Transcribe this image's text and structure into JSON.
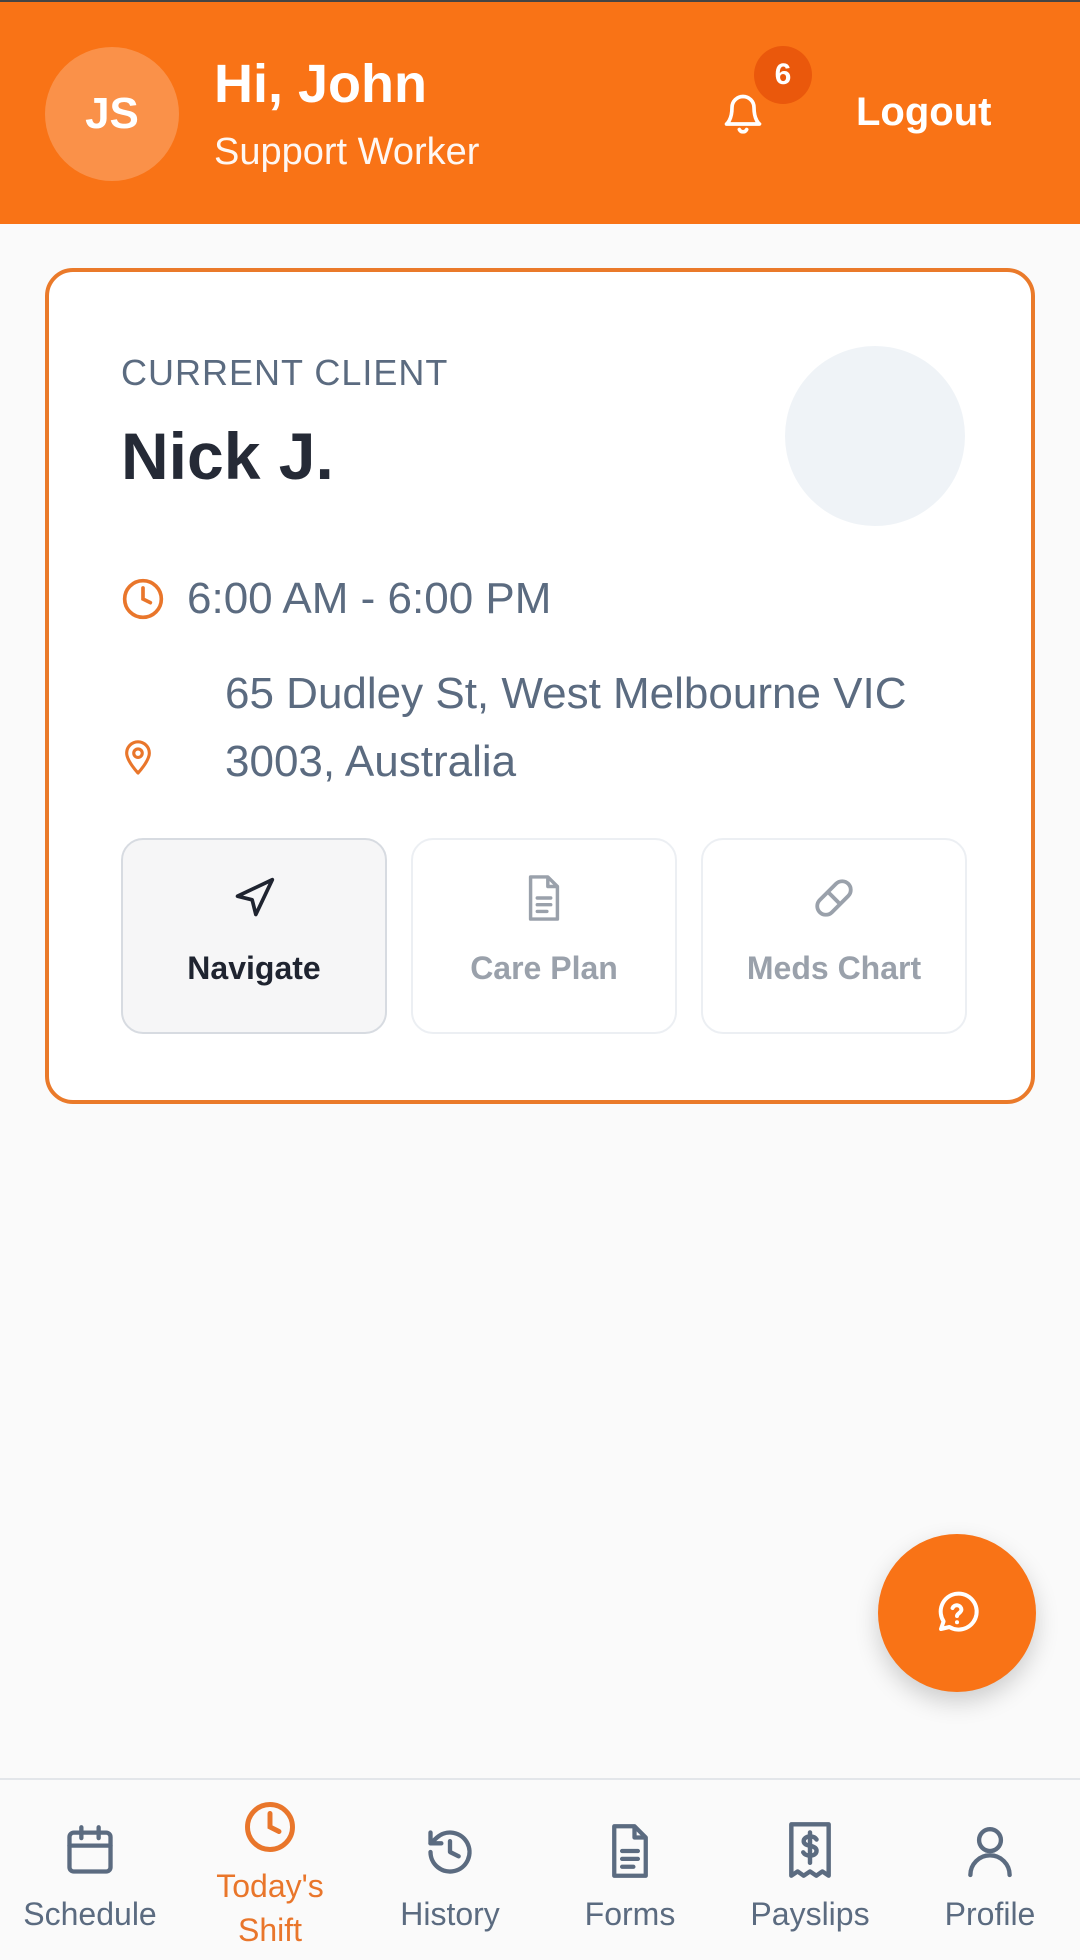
{
  "header": {
    "avatar_initials": "JS",
    "greeting": "Hi, John",
    "role": "Support Worker",
    "notification_count": "6",
    "logout_label": "Logout"
  },
  "client_card": {
    "label": "CURRENT CLIENT",
    "name": "Nick J.",
    "time": "6:00 AM - 6:00 PM",
    "address": "65 Dudley St, West Melbourne VIC 3003, Australia",
    "actions": [
      {
        "label": "Navigate",
        "icon": "navigation-arrow-icon"
      },
      {
        "label": "Care Plan",
        "icon": "document-icon"
      },
      {
        "label": "Meds Chart",
        "icon": "pill-icon"
      }
    ]
  },
  "bottom_nav": {
    "items": [
      {
        "label": "Schedule",
        "icon": "calendar-icon"
      },
      {
        "label": "Today's Shift",
        "icon": "clock-icon"
      },
      {
        "label": "History",
        "icon": "history-icon"
      },
      {
        "label": "Forms",
        "icon": "document-icon"
      },
      {
        "label": "Payslips",
        "icon": "receipt-dollar-icon"
      },
      {
        "label": "Profile",
        "icon": "user-icon"
      }
    ],
    "active_index": 1
  },
  "colors": {
    "brand": "#f97316",
    "active_nav": "#e9762b",
    "muted_text": "#5b6b80"
  }
}
